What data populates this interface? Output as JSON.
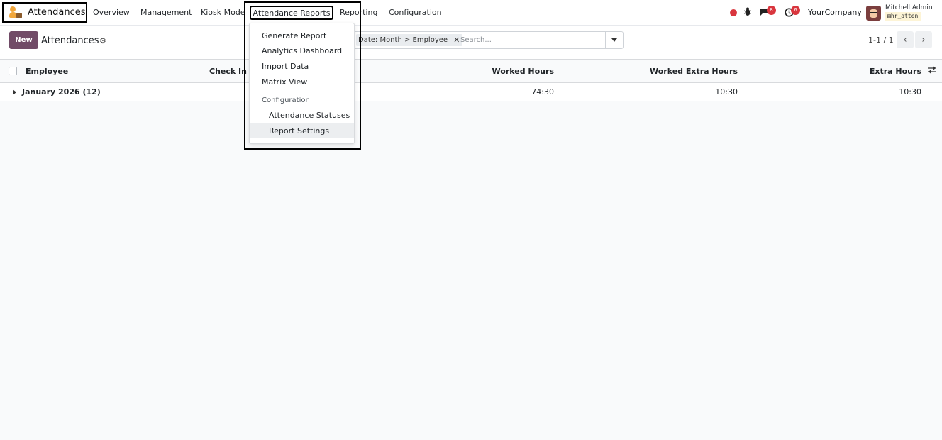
{
  "app": {
    "name": "Attendances"
  },
  "nav": {
    "items": [
      "Overview",
      "Management",
      "Kiosk Mode",
      "Attendance Reports",
      "Reporting",
      "Configuration"
    ],
    "active": "Attendance Reports"
  },
  "systray": {
    "messages_count": "8",
    "activities_count": "6",
    "company": "YourCompany",
    "user_name": "Mitchell Admin",
    "database": "hr_atten"
  },
  "control": {
    "new_label": "New",
    "title": "Attendances",
    "facet": "Date: Month > Employee",
    "search_placeholder": "Search...",
    "pager": "1-1 / 1"
  },
  "table": {
    "columns": [
      "Employee",
      "Check In",
      "Worked Hours",
      "Worked Extra Hours",
      "Extra Hours"
    ],
    "groups": [
      {
        "label": "January 2026 (12)",
        "worked_hours": "74:30",
        "worked_extra_hours": "10:30",
        "extra_hours": "10:30"
      }
    ]
  },
  "dropdown": {
    "items": [
      "Generate Report",
      "Analytics Dashboard",
      "Import Data",
      "Matrix View"
    ],
    "section": "Configuration",
    "sub_items": [
      "Attendance Statuses",
      "Report Settings"
    ]
  },
  "colors": {
    "brand": "#714b67",
    "badge": "#d9363e"
  }
}
